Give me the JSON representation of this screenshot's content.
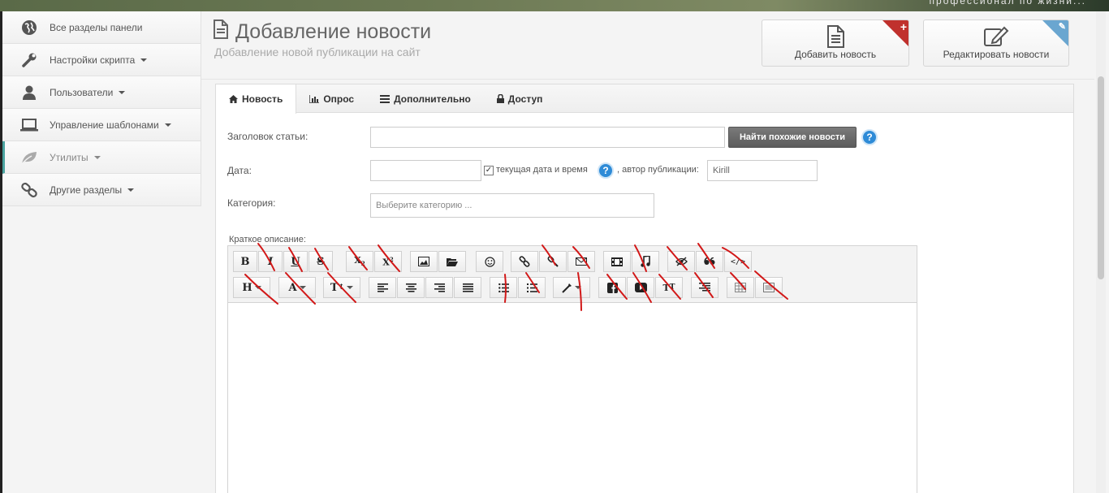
{
  "banner": {
    "slogan": "профессионал по жизни..."
  },
  "sidebar": {
    "items": [
      {
        "label": "Все разделы панели",
        "icon": "globe-icon",
        "has_caret": false
      },
      {
        "label": "Настройки скрипта",
        "icon": "wrench-icon",
        "has_caret": true
      },
      {
        "label": "Пользователи",
        "icon": "user-icon",
        "has_caret": true
      },
      {
        "label": "Управление шаблонами",
        "icon": "laptop-icon",
        "has_caret": true
      },
      {
        "label": "Утилиты",
        "icon": "leaf-icon",
        "has_caret": true
      },
      {
        "label": "Другие разделы",
        "icon": "link-icon",
        "has_caret": true
      }
    ]
  },
  "header": {
    "title": "Добавление новости",
    "subtitle": "Добавление новой публикации на сайт",
    "add_button": "Добавить новость",
    "edit_button": "Редактировать новости"
  },
  "tabs": [
    {
      "label": "Новость",
      "icon": "home-icon",
      "active": true
    },
    {
      "label": "Опрос",
      "icon": "bar-chart-icon",
      "active": false
    },
    {
      "label": "Дополнительно",
      "icon": "list-icon",
      "active": false
    },
    {
      "label": "Доступ",
      "icon": "lock-icon",
      "active": false
    }
  ],
  "form": {
    "title_label": "Заголовок статьи:",
    "title_value": "",
    "find_similar_button": "Найти похожие новости",
    "date_label": "Дата:",
    "date_value": "",
    "current_date_checkbox_label": "текущая дата и время",
    "current_date_checked": true,
    "author_label": ", автор публикации:",
    "author_value": "Kirill",
    "category_label": "Категория:",
    "category_placeholder": "Выберите категорию ...",
    "short_desc_label": "Краткое описание:"
  },
  "editor_toolbar": {
    "row1": [
      "bold",
      "italic",
      "underline",
      "strikethrough",
      "subscript",
      "superscript",
      "image",
      "folder",
      "emoticon",
      "link",
      "unlink",
      "email",
      "video",
      "audio",
      "hide",
      "quote",
      "code"
    ],
    "row2": [
      "heading",
      "font",
      "font-size",
      "align-left",
      "align-center",
      "align-right",
      "align-justify",
      "bullet-list",
      "numbered-list",
      "color",
      "facebook",
      "youtube",
      "typography",
      "page-break",
      "table",
      "widget"
    ],
    "labels": {
      "bold": "B",
      "italic": "I",
      "underline": "U",
      "strike": "S",
      "heading": "H",
      "font": "A",
      "font_size": "T",
      "typo": "T"
    }
  }
}
